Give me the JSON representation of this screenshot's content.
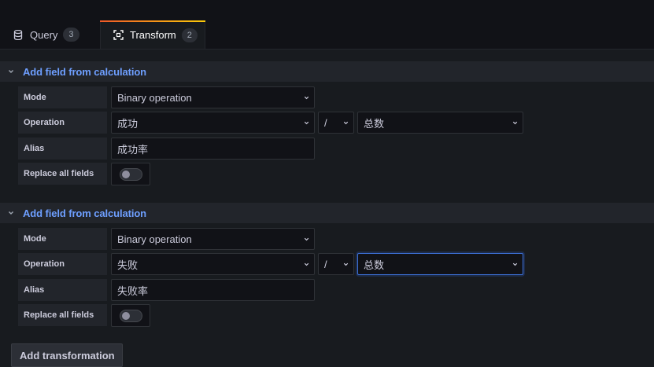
{
  "tabs": [
    {
      "label": "Query",
      "count": "3",
      "icon": "database-icon"
    },
    {
      "label": "Transform",
      "count": "2",
      "icon": "transform-icon",
      "active": true
    }
  ],
  "transformations": [
    {
      "title": "Add field from calculation",
      "mode_label": "Mode",
      "mode_value": "Binary operation",
      "operation_label": "Operation",
      "left_field": "成功",
      "operator": "/",
      "right_field": "总数",
      "alias_label": "Alias",
      "alias_value": "成功率",
      "replace_label": "Replace all fields",
      "replace_on": false
    },
    {
      "title": "Add field from calculation",
      "mode_label": "Mode",
      "mode_value": "Binary operation",
      "operation_label": "Operation",
      "left_field": "失败",
      "operator": "/",
      "right_field": "总数",
      "alias_label": "Alias",
      "alias_value": "失败率",
      "replace_label": "Replace all fields",
      "replace_on": false
    }
  ],
  "add_button": {
    "label": "Add transformation"
  },
  "colors": {
    "accent_blue": "#6e9fff",
    "tab_gradient_start": "#f05a28",
    "tab_gradient_end": "#fbca0a",
    "focus_blue": "#3d71d9"
  }
}
